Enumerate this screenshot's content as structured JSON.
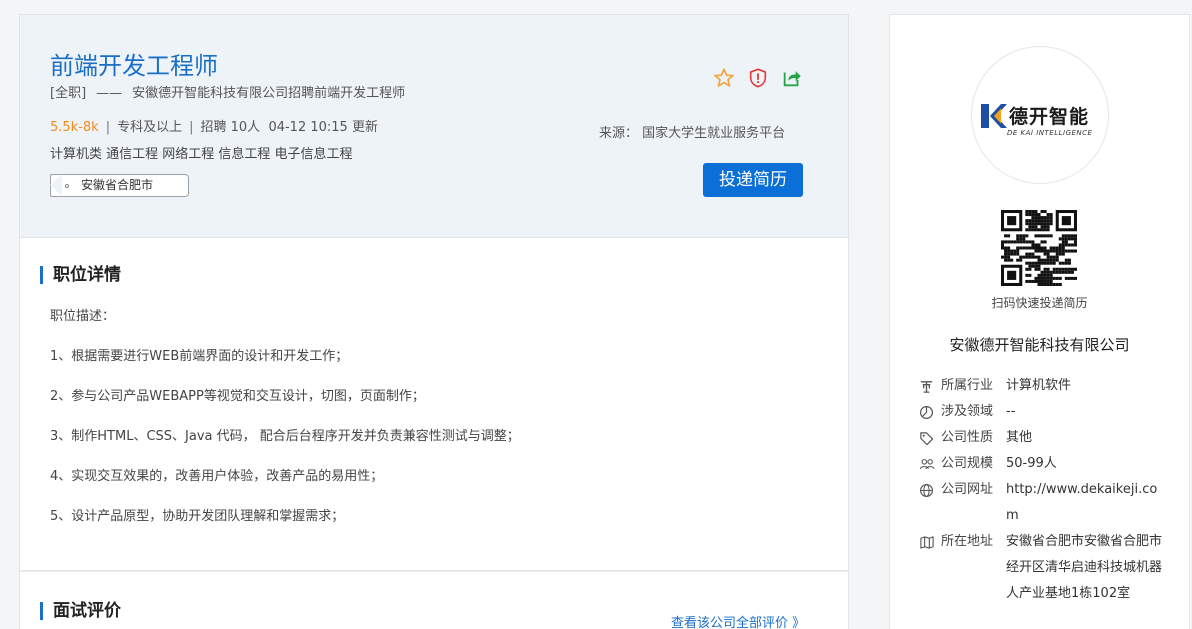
{
  "job": {
    "title": "前端开发工程师",
    "type": "[全职]",
    "dash": "——",
    "subtitle": "安徽德开智能科技有限公司招聘前端开发工程师",
    "salary": "5.5k-8k",
    "sep": "|",
    "education": "专科及以上",
    "recruit": "招聘 10人",
    "updated": "04-12 10:15 更新",
    "majors": "计算机类 通信工程 网络工程 信息工程 电子信息工程",
    "location": "安徽省合肥市",
    "source": "来源： 国家大学生就业服务平台",
    "apply_label": "投递简历"
  },
  "icons": {
    "favorite": "star-icon",
    "report": "shield-alert-icon",
    "share": "share-icon",
    "accent_colors": {
      "star": "#f3a33a",
      "shield": "#e23a3a",
      "share": "#27a54b",
      "primary": "#0a6fd6"
    }
  },
  "detail": {
    "title": "职位详情",
    "lines": [
      "职位描述：",
      "1、根据需要进行WEB前端界面的设计和开发工作；",
      "2、参与公司产品WEBAPP等视觉和交互设计，切图，页面制作；",
      " 3、制作HTML、CSS、Java 代码， 配合后台程序开发并负责兼容性测试与调整；",
      " 4、实现交互效果的，改善用户体验，改善产品的易用性；",
      " 5、设计产品原型，协助开发团队理解和掌握需求；"
    ]
  },
  "review": {
    "title": "面试评价",
    "link": "查看该公司全部评价 》"
  },
  "company": {
    "logo_text": "德开智能",
    "logo_sub": "DE KAI INTELLIGENCE",
    "qr_caption": "扫码快速投递简历",
    "name": "安徽德开智能科技有限公司",
    "info": [
      {
        "icon": "industry-icon",
        "label": "所属行业",
        "value": "计算机软件"
      },
      {
        "icon": "pie-chart-icon",
        "label": "涉及领域",
        "value": "--"
      },
      {
        "icon": "tag-icon",
        "label": "公司性质",
        "value": "其他"
      },
      {
        "icon": "people-icon",
        "label": "公司规模",
        "value": "50-99人"
      },
      {
        "icon": "globe-icon",
        "label": "公司网址",
        "value": "http://www.dekaikeji.com"
      },
      {
        "icon": "map-icon",
        "label": "所在地址",
        "value": "安徽省合肥市安徽省合肥市经开区清华启迪科技城机器人产业基地1栋102室"
      }
    ]
  }
}
